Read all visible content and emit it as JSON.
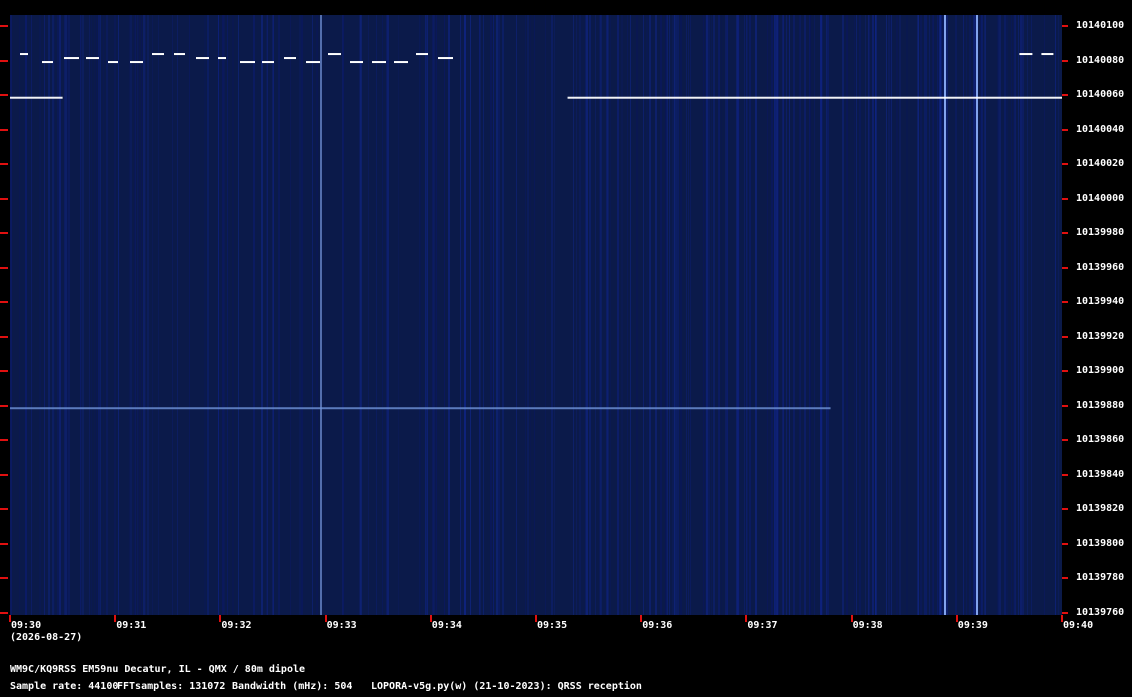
{
  "waterfall": {
    "frequency_axis": {
      "labels": [
        "10140100",
        "10140080",
        "10140060",
        "10140040",
        "10140020",
        "10140000",
        "10139980",
        "10139960",
        "10139940",
        "10139920",
        "10139900",
        "10139880",
        "10139860",
        "10139840",
        "10139820",
        "10139800",
        "10139780",
        "10139760"
      ]
    },
    "time_axis": {
      "labels": [
        "09:30",
        "09:31",
        "09:32",
        "09:33",
        "09:34",
        "09:35",
        "09:36",
        "09:37",
        "09:38",
        "09:39",
        "09:40"
      ],
      "date": "(2026-08-27)"
    },
    "signals": [
      {
        "freq_hz": 10140082,
        "start": "09:30",
        "end": "09:34",
        "style": "dashed"
      },
      {
        "freq_hz": 10140059,
        "start": "09:30",
        "end": "09:30.5",
        "style": "solid"
      },
      {
        "freq_hz": 10140059,
        "start": "09:35.3",
        "end": "09:40",
        "style": "solid"
      },
      {
        "freq_hz": 10139879,
        "start": "09:30",
        "end": "09:37.8",
        "style": "faint"
      },
      {
        "freq_hz": 10140082,
        "start": "09:39.5",
        "end": "09:39.8",
        "style": "dashed"
      }
    ],
    "colors": {
      "background": "#0b1a4a",
      "signal": "#ffffff",
      "tick": "#e01010"
    }
  },
  "footer": {
    "station": "WM9C/KQ9RSS EM59nu Decatur, IL - QMX / 80m dipole",
    "sample_rate": "Sample rate: 44100",
    "fft_samples": "FFTsamples: 131072",
    "bandwidth": "Bandwidth (mHz): 504",
    "software": "LOPORA-v5g.py(w) (21-10-2023): QRSS reception"
  }
}
